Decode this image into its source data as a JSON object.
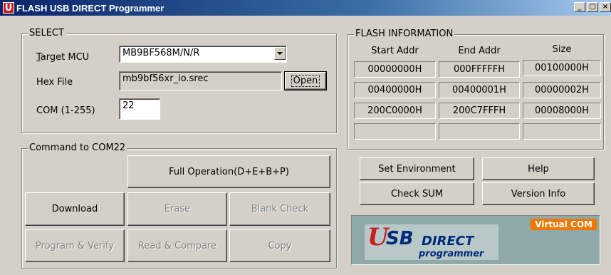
{
  "window": {
    "title": "FLASH USB DIRECT Programmer",
    "app_icon_letter": "U"
  },
  "select": {
    "legend": "SELECT",
    "target_mcu_label": "Target MCU",
    "target_mcu_value": "MB9BF568M/N/R",
    "hex_file_label": "Hex File",
    "hex_file_value": "mb9bf56xr_io.srec",
    "open_button": "Open",
    "com_label": "COM (1-255)",
    "com_value": "22"
  },
  "command": {
    "legend": "Command to COM22",
    "full_operation": "Full Operation(D+E+B+P)",
    "download": "Download",
    "erase": "Erase",
    "blank_check": "Blank Check",
    "program_verify": "Program & Verify",
    "read_compare": "Read & Compare",
    "copy": "Copy"
  },
  "flash_info": {
    "legend": "FLASH INFORMATION",
    "headers": [
      "Start Addr",
      "End Addr",
      "Size"
    ],
    "rows": [
      [
        "00000000H",
        "000FFFFFH",
        "00100000H"
      ],
      [
        "00400000H",
        "00400001H",
        "00000002H"
      ],
      [
        "200C0000H",
        "200C7FFFH",
        "00008000H"
      ],
      [
        "",
        "",
        ""
      ]
    ]
  },
  "buttons": {
    "set_environment": "Set Environment",
    "help": "Help",
    "check_sum": "Check SUM",
    "version_info": "Version Info"
  },
  "logo": {
    "virtual_com": "Virtual COM",
    "u": "U",
    "sb": "SB",
    "direct": "DIRECT",
    "programmer": "programmer"
  },
  "colors": {
    "title_bar": "#0a246a",
    "face": "#d4d0c8",
    "accent": "#f07800",
    "logo_red": "#c81e1e",
    "logo_blue": "#002a7a"
  }
}
